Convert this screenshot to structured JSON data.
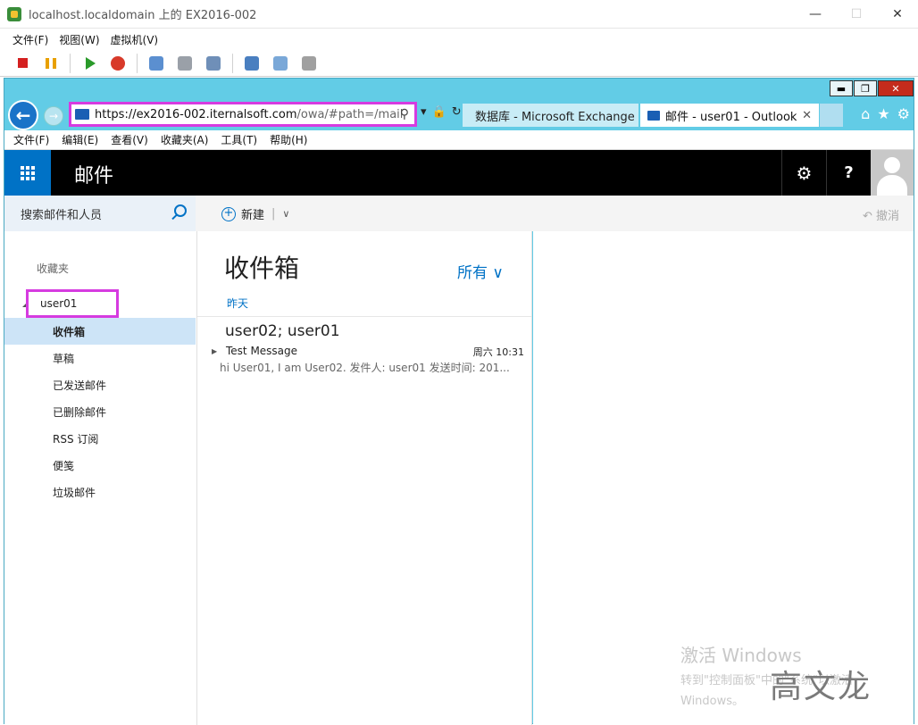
{
  "vm_window": {
    "title": "localhost.localdomain 上的 EX2016-002",
    "minimize": "—",
    "maximize": "☐",
    "close": "✕",
    "menu": [
      "文件(F)",
      "视图(W)",
      "虚拟机(V)"
    ]
  },
  "ie": {
    "address_scheme": "https://ex2016-002.",
    "address_host": "iternalsoft.com",
    "address_path": "/owa/#path=/mail",
    "tabs": [
      {
        "label": "数据库 - Microsoft Exchange"
      },
      {
        "label": "邮件 - user01 - Outlook",
        "close": "✕"
      }
    ],
    "menu": [
      "文件(F)",
      "编辑(E)",
      "查看(V)",
      "收藏夹(A)",
      "工具(T)",
      "帮助(H)"
    ],
    "win_buttons": [
      "▬",
      "❐",
      "✕"
    ]
  },
  "owa": {
    "app_title": "邮件",
    "gear": "⚙",
    "help": "?",
    "search_placeholder": "搜索邮件和人员",
    "new_label": "新建",
    "new_plus": "+",
    "new_divider": "|",
    "new_caret": "∨",
    "undo_label": "↶ 撤消",
    "favorites_label": "收藏夹",
    "account": "user01",
    "folders": [
      "收件箱",
      "草稿",
      "已发送邮件",
      "已删除邮件",
      "RSS 订阅",
      "便笺",
      "垃圾邮件"
    ],
    "list_title": "收件箱",
    "filter_label": "所有",
    "filter_caret": "∨",
    "group_label": "昨天",
    "messages": [
      {
        "from": "user02; user01",
        "subject": "Test Message",
        "time": "周六 10:31",
        "preview": "hi User01, I am User02. 发件人: user01 发送时间: 201..."
      }
    ]
  },
  "activation": {
    "title": "激活 Windows",
    "line1": "转到\"控制面板\"中的\"系统\"以激活",
    "line2": "Windows。"
  },
  "author_mark": "高文龙"
}
